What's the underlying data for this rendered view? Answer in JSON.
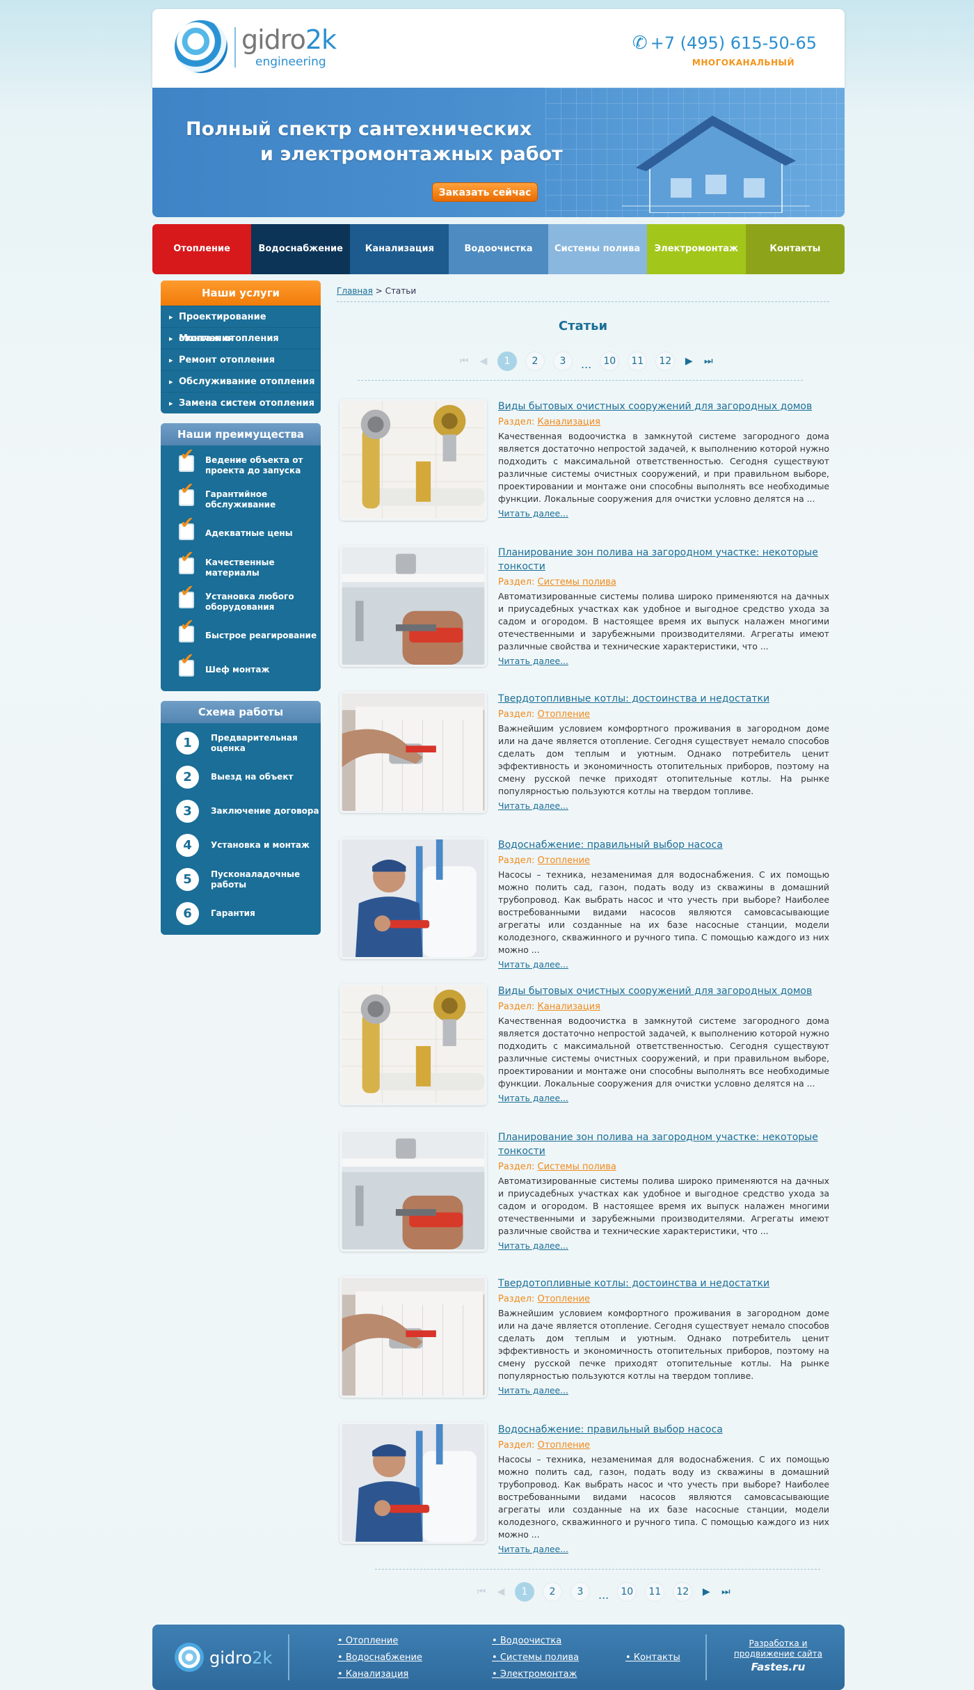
{
  "header": {
    "logo_main": "gidro",
    "logo_accent": "2k",
    "logo_sub": "engineering",
    "phone": "+7 (495) 615-50-65",
    "phone_sub": "многоканальный"
  },
  "banner": {
    "line1": "Полный спектр сантехнических",
    "line2": "и электромонтажных работ",
    "cta": "Заказать сейчас"
  },
  "nav": [
    {
      "label": "Отопление",
      "color": "#d7191c"
    },
    {
      "label": "Водоснабжение",
      "color": "#0c3457"
    },
    {
      "label": "Канализация",
      "color": "#1d5b8f"
    },
    {
      "label": "Водоочистка",
      "color": "#4d8bc1"
    },
    {
      "label": "Системы полива",
      "color": "#8ab7de"
    },
    {
      "label": "Электромонтаж",
      "color": "#a3c61b"
    },
    {
      "label": "Контакты",
      "color": "#8da41a"
    }
  ],
  "sidebar": {
    "services_title": "Наши услуги",
    "services": [
      "Проектирование отопления",
      "Монтаж отопления",
      "Ремонт отопления",
      "Обслуживание отопления",
      "Замена систем отопления"
    ],
    "advantages_title": "Наши преимущества",
    "advantages": [
      "Ведение объекта от проекта до запуска",
      "Гарантийное обслуживание",
      "Адекватные цены",
      "Качественные материалы",
      "Установка любого оборудования",
      "Быстрое реагирование",
      "Шеф монтаж"
    ],
    "scheme_title": "Схема работы",
    "steps": [
      {
        "num": "1",
        "label": "Предварительная оценка"
      },
      {
        "num": "2",
        "label": "Выезд на объект"
      },
      {
        "num": "3",
        "label": "Заключение договора"
      },
      {
        "num": "4",
        "label": "Установка и монтаж"
      },
      {
        "num": "5",
        "label": "Пусконаладочные работы"
      },
      {
        "num": "6",
        "label": "Гарантия"
      }
    ]
  },
  "breadcrumb": {
    "home": "Главная",
    "sep": ">",
    "current": "Статьи"
  },
  "page_title": "Статьи",
  "pager": {
    "pages": [
      "1",
      "2",
      "3"
    ],
    "dots": "...",
    "pages_end": [
      "10",
      "11",
      "12"
    ],
    "active": "1"
  },
  "section_prefix": "Раздел:",
  "read_more": "Читать далее...",
  "articles": [
    {
      "title": "Виды бытовых очистных сооружений для загородных домов",
      "section": "Канализация",
      "text": "Качественная водоочистка в замкнутой системе загородного дома является достаточно непростой задачей, к выполнению которой нужно подходить с максимальной ответственностью. Сегодня существуют различные системы очистных сооружений, и при правильном выборе, проектировании и монтаже они способны выполнять все необходимые функции. Локальные сооружения для очистки условно делятся на ...",
      "img": "valves"
    },
    {
      "title": "Планирование зон полива на загородном участке: некоторые тонкости",
      "section": "Системы полива",
      "text": "Автоматизированные системы полива широко применяются на дачных и приусадебных участках как удобное и выгодное средство ухода за садом и огородом. В настоящее время их выпуск налажен многими отечественными и зарубежными производителями. Агрегаты имеют различные свойства и технические характеристики, что ...",
      "img": "sink"
    },
    {
      "title": "Твердотопливные котлы: достоинства и недостатки",
      "section": "Отопление",
      "text": "Важнейшим условием комфортного проживания в загородном доме или на даче является отопление. Сегодня существует немало способов сделать дом теплым и уютным. Однако потребитель ценит эффективность и экономичность отопительных приборов, поэтому на смену русской печке приходят отопительные котлы. На рынке популярностью пользуются котлы на твердом топливе.",
      "img": "radiator"
    },
    {
      "title": "Водоснабжение: правильный выбор насоса",
      "section": "Отопление",
      "text": "Насосы – техника, незаменимая для водоснабжения. С их помощью можно полить сад, газон, подать воду из скважины в домашний трубопровод. Как выбрать насос и что учесть при выборе? Наиболее востребованными видами насосов являются самовсасывающие агрегаты или созданные на их базе насосные станции, модели колодезного, скважинного и ручного типа. С помощью каждого из них можно ...",
      "img": "plumber"
    },
    {
      "title": "Виды бытовых очистных сооружений для загородных домов",
      "section": "Канализация",
      "text": "Качественная водоочистка в замкнутой системе загородного дома является достаточно непростой задачей, к выполнению которой нужно подходить с максимальной ответственностью. Сегодня существуют различные системы очистных сооружений, и при правильном выборе, проектировании и монтаже они способны выполнять все необходимые функции. Локальные сооружения для очистки условно делятся на ...",
      "img": "valves"
    },
    {
      "title": "Планирование зон полива на загородном участке: некоторые тонкости",
      "section": "Системы полива",
      "text": "Автоматизированные системы полива широко применяются на дачных и приусадебных участках как удобное и выгодное средство ухода за садом и огородом. В настоящее время их выпуск налажен многими отечественными и зарубежными производителями. Агрегаты имеют различные свойства и технические характеристики, что ...",
      "img": "sink"
    },
    {
      "title": "Твердотопливные котлы: достоинства и недостатки",
      "section": "Отопление",
      "text": "Важнейшим условием комфортного проживания в загородном доме или на даче является отопление. Сегодня существует немало способов сделать дом теплым и уютным. Однако потребитель ценит эффективность и экономичность отопительных приборов, поэтому на смену русской печке приходят отопительные котлы. На рынке популярностью пользуются котлы на твердом топливе.",
      "img": "radiator"
    },
    {
      "title": "Водоснабжение: правильный выбор насоса",
      "section": "Отопление",
      "text": "Насосы – техника, незаменимая для водоснабжения. С их помощью можно полить сад, газон, подать воду из скважины в домашний трубопровод. Как выбрать насос и что учесть при выборе? Наиболее востребованными видами насосов являются самовсасывающие агрегаты или созданные на их базе насосные станции, модели колодезного, скважинного и ручного типа. С помощью каждого из них можно ...",
      "img": "plumber"
    }
  ],
  "footer": {
    "logo_main": "gidro",
    "logo_accent": "2k",
    "col1": [
      "Отопление",
      "Водоснабжение",
      "Канализация"
    ],
    "col2": [
      "Водоочистка",
      "Системы полива",
      "Электромонтаж"
    ],
    "col3": [
      "Контакты"
    ],
    "dev_line1": "Разработка и",
    "dev_line2": "продвижение сайта",
    "dev_brand": "Fastes.ru"
  }
}
